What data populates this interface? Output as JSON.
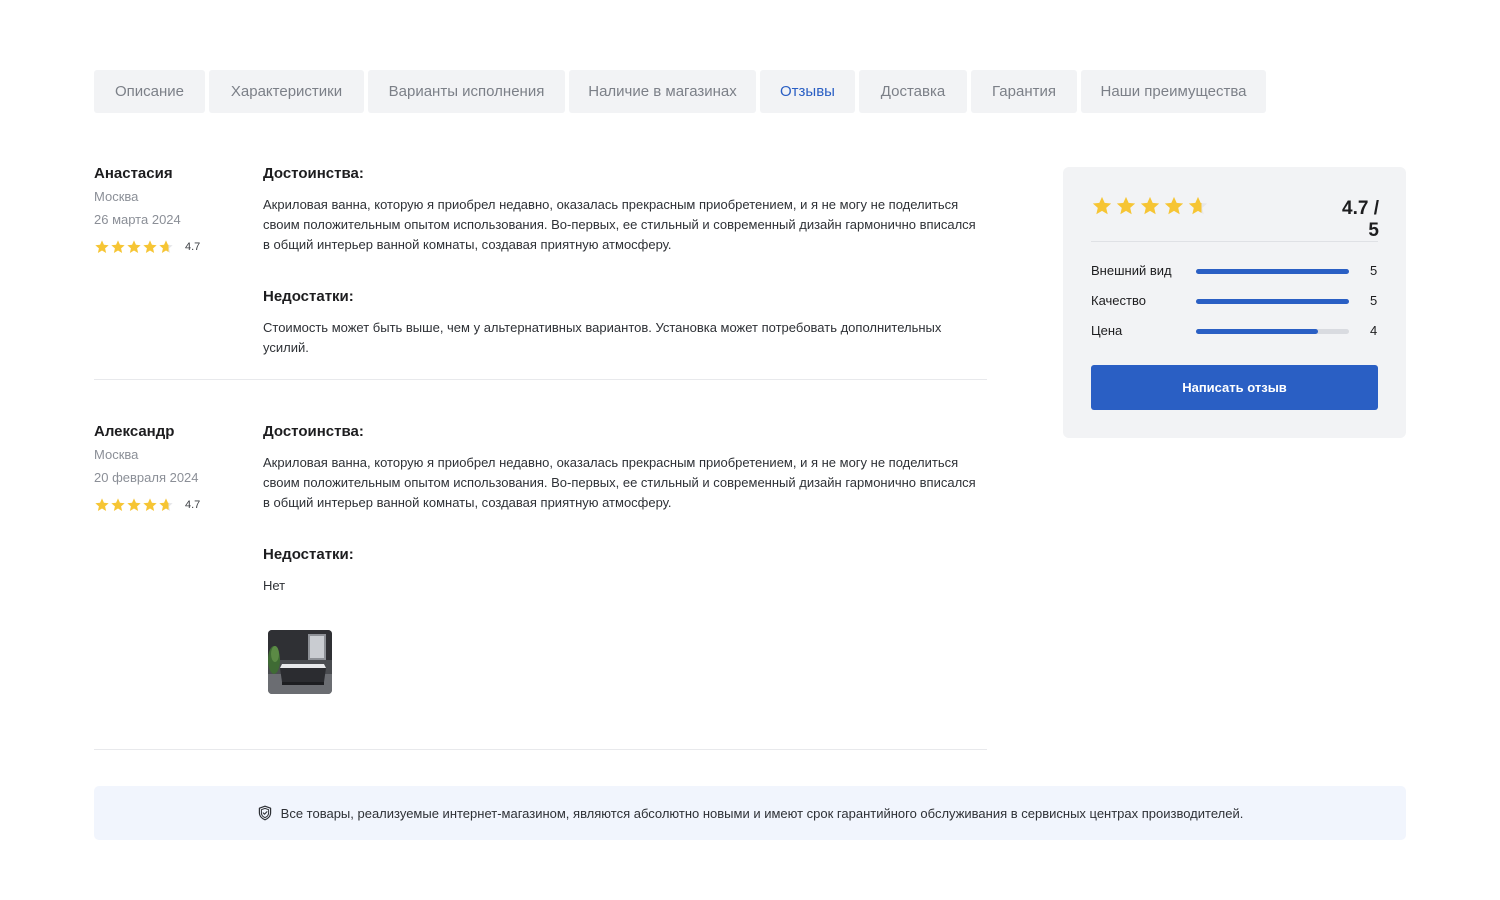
{
  "tabs": [
    {
      "label": "Описание",
      "active": false
    },
    {
      "label": "Характеристики",
      "active": false
    },
    {
      "label": "Варианты исполнения",
      "active": false
    },
    {
      "label": "Наличие в магазинах",
      "active": false
    },
    {
      "label": "Отзывы",
      "active": true
    },
    {
      "label": "Доставка",
      "active": false
    },
    {
      "label": "Гарантия",
      "active": false
    },
    {
      "label": "Наши преимущества",
      "active": false
    }
  ],
  "reviews": [
    {
      "author": "Анастасия",
      "city": "Москва",
      "date": "26 марта 2024",
      "rating": 4.7,
      "rating_text": "4.7",
      "pros_title": "Достоинства:",
      "pros_text": "Акриловая ванна, которую я приобрел недавно, оказалась прекрасным приобретением, и я не могу не поделиться своим положительным опытом использования. Во-первых, ее стильный и современный дизайн гармонично вписался в общий интерьер ванной комнаты, создавая приятную атмосферу.",
      "cons_title": "Недостатки:",
      "cons_text": "Стоимость может быть выше, чем у альтернативных вариантов. Установка может потребовать дополнительных усилий."
    },
    {
      "author": "Александр",
      "city": "Москва",
      "date": "20 февраля 2024",
      "rating": 4.7,
      "rating_text": "4.7",
      "pros_title": "Достоинства:",
      "pros_text": "Акриловая ванна, которую я приобрел недавно, оказалась прекрасным приобретением, и я не могу не поделиться своим положительным опытом использования. Во-первых, ее стильный и современный дизайн гармонично вписался в общий интерьер ванной комнаты, создавая приятную атмосферу.",
      "cons_title": "Недостатки:",
      "cons_text": "Нет",
      "photo_icon": "bathroom-photo"
    }
  ],
  "summary": {
    "rating": 4.7,
    "score_text": "4.7 / 5",
    "criteria": [
      {
        "label": "Внешний вид",
        "value": 5,
        "value_text": "5"
      },
      {
        "label": "Качество",
        "value": 5,
        "value_text": "5"
      },
      {
        "label": "Цена",
        "value": 4,
        "value_text": "4"
      }
    ],
    "button_label": "Написать отзыв"
  },
  "notice": {
    "icon": "shield-check-icon",
    "text": "Все товары, реализуемые интернет-магазином, являются абсолютно новыми и имеют срок гарантийного обслуживания в сервисных центрах производителей."
  },
  "colors": {
    "accent": "#2a5fc4",
    "star": "#f6c534",
    "star_empty": "#e6e7ea"
  }
}
